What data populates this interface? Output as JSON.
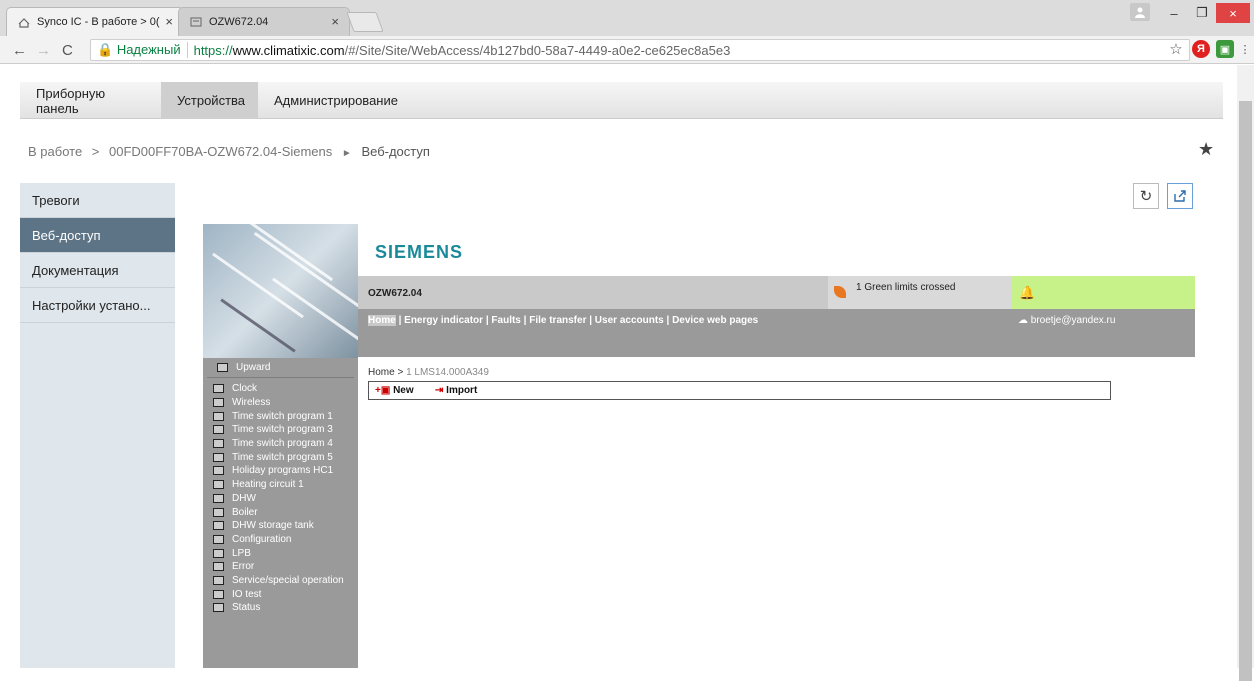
{
  "browser": {
    "tabs": [
      {
        "title": "Synco IC - В работе > 0(",
        "close": "×"
      },
      {
        "title": "OZW672.04",
        "close": "×"
      }
    ],
    "window_controls": {
      "minimize": "–",
      "restore": "❐",
      "close": "×"
    },
    "address": {
      "secure_label": "Надежный",
      "url_scheme": "https://",
      "url_host": "www.climatixic.com",
      "url_path": "/#/Site/Site/WebAccess/4b127bd0-58a7-4449-a0e2-ce625ec8a5e3"
    }
  },
  "app": {
    "menu": [
      "Приборную панель",
      "Устройства",
      "Администрирование"
    ],
    "breadcrumb": {
      "root": "В работе",
      "sep1": ">",
      "device": "00FD00FF70BA-OZW672.04-Siemens",
      "sep2": "►",
      "current": "Веб-доступ"
    },
    "sidebar": [
      "Тревоги",
      "Веб-доступ",
      "Документация",
      "Настройки устано..."
    ]
  },
  "device_page": {
    "brand": "SIEMENS",
    "device_name": "OZW672.04",
    "limits_text": "1 Green limits crossed",
    "links": {
      "home": "Home",
      "rest": " | Energy indicator | Faults | File transfer | User accounts | Device web pages"
    },
    "user": "broetje@yandex.ru",
    "path": {
      "home": "Home >",
      "node": " 1 LMS14.000A349"
    },
    "actions": {
      "new": "New",
      "import": "Import"
    },
    "nav_up": "Upward",
    "nav_items": [
      "Clock",
      "Wireless",
      "Time switch program 1",
      "Time switch program 3",
      "Time switch program 4",
      "Time switch program 5",
      "Holiday programs HC1",
      "Heating circuit 1",
      "DHW",
      "Boiler",
      "DHW storage tank",
      "Configuration",
      "LPB",
      "Error",
      "Service/special operation",
      "IO test",
      "Status"
    ]
  }
}
